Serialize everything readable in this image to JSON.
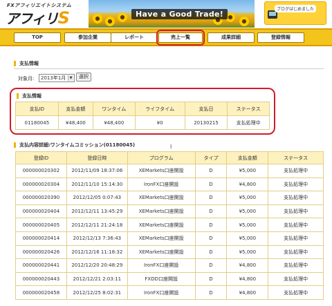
{
  "header": {
    "brand_sub": "FXアフィリエイトシステム",
    "brand_main": "アフィリ",
    "brand_suffix": "S",
    "banner_text": "Have a Good Trade!",
    "blog_label": "ブログはじめました"
  },
  "nav": [
    {
      "label": "TOP"
    },
    {
      "label": "参加企業"
    },
    {
      "label": "レポート"
    },
    {
      "label": "売上一覧"
    },
    {
      "label": "成果詳細"
    },
    {
      "label": "登録情報"
    }
  ],
  "payment": {
    "section_title": "支払情報",
    "target_label": "対象月:",
    "selected_month": "2013年1月",
    "select_button": "選択"
  },
  "summary": {
    "section_title": "支払情報",
    "headers": [
      "支払ID",
      "支払金額",
      "ワンタイム",
      "ライフタイム",
      "支払日",
      "ステータス"
    ],
    "row": [
      "01180045",
      "¥48,400",
      "¥48,400",
      "¥0",
      "20130215",
      "支払処理中"
    ]
  },
  "detail": {
    "section_title": "支払内容詳細:ワンタイムコミッション(01180045)",
    "headers": [
      "登録ID",
      "登録日時",
      "プログラム",
      "タイプ",
      "支払金額",
      "ステータス"
    ],
    "rows": [
      [
        "000000020302",
        "2012/11/09 18:37:06",
        "XEMarkets口座開設",
        "D",
        "¥5,000",
        "支払処理中"
      ],
      [
        "000000020304",
        "2012/11/10 15:14:30",
        "IronFX口座開設",
        "D",
        "¥4,800",
        "支払処理中"
      ],
      [
        "000000020390",
        "2012/12/05 0:07:43",
        "XEMarkets口座開設",
        "D",
        "¥5,000",
        "支払処理中"
      ],
      [
        "000000020404",
        "2012/12/11 13:45:29",
        "XEMarkets口座開設",
        "D",
        "¥5,000",
        "支払処理中"
      ],
      [
        "000000020405",
        "2012/12/11 21:24:18",
        "XEMarkets口座開設",
        "D",
        "¥5,000",
        "支払処理中"
      ],
      [
        "000000020414",
        "2012/12/13 7:36:43",
        "XEMarkets口座開設",
        "D",
        "¥5,000",
        "支払処理中"
      ],
      [
        "000000020426",
        "2012/12/16 11:18:32",
        "XEMarkets口座開設",
        "D",
        "¥5,000",
        "支払処理中"
      ],
      [
        "000000020441",
        "2012/12/20 20:48:29",
        "IronFX口座開設",
        "D",
        "¥4,800",
        "支払処理中"
      ],
      [
        "000000020443",
        "2012/12/21 2:03:11",
        "FXDD口座開設",
        "D",
        "¥4,800",
        "支払処理中"
      ],
      [
        "000000020458",
        "2012/12/25 8:02:31",
        "IronFX口座開設",
        "D",
        "¥4,800",
        "支払処理中"
      ]
    ]
  },
  "colors": {
    "nav_bg": "#f3c41c",
    "table_header_bg": "#fdf1bf",
    "highlight_red": "#d11a2a",
    "accent": "#f0b400"
  }
}
